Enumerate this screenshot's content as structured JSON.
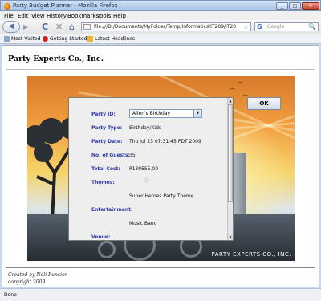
{
  "window": {
    "title": "Party Budget Planner - Mozilla Firefox",
    "minimize": "_",
    "maximize": "□",
    "close": "✕"
  },
  "menu": [
    "File",
    "Edit",
    "View",
    "History",
    "Bookmarks",
    "Tools",
    "Help"
  ],
  "nav": {
    "back_icon": "◀",
    "forward_icon": "▶",
    "reload_icon": "C",
    "stop_icon": "✕",
    "home_icon": "⌂",
    "url": "file:///D:/Documents/MyFolder/Temp/Informatics/IT209/IT20",
    "star_icon": "☆",
    "search_placeholder": "Google",
    "search_engine_icon": "G",
    "search_icon": "🔍"
  },
  "bookmarks": [
    "Most Visited",
    "Getting Started",
    "Latest Headlines"
  ],
  "page": {
    "title": "Party Experts Co., Inc.",
    "banner_text": "PARTY EXPERTS CO., INC.",
    "ok_label": "OK",
    "footer_created": "Created by Noli Puncion",
    "footer_copyright": "copyright 2009"
  },
  "dialog": {
    "party_id_label": "Party ID:",
    "party_id_value": "Allen's Birthday",
    "party_type_label": "Party Type:",
    "party_type_value": "Birthday/Kids",
    "party_date_label": "Party Date:",
    "party_date_value": "Thu Jul 23 07:31:45 PDT 2009",
    "guests_label": "No. of Guests:",
    "guests_value": "35",
    "total_cost_label": "Total Cost:",
    "total_cost_value": "P139555.00",
    "themes_label": "Themes:",
    "themes_value": "Super Heroes Party Theme",
    "entertainment_label": "Entertainment:",
    "entertainment_value": "Music Band",
    "venue_label": "Venue:",
    "combo_arrow": "▼",
    "scroll_up": "▲",
    "scroll_down": "▼"
  },
  "status": "Done",
  "colors": {
    "label_blue": "#2b3aa8",
    "title_bar": "#a9c4e6"
  }
}
